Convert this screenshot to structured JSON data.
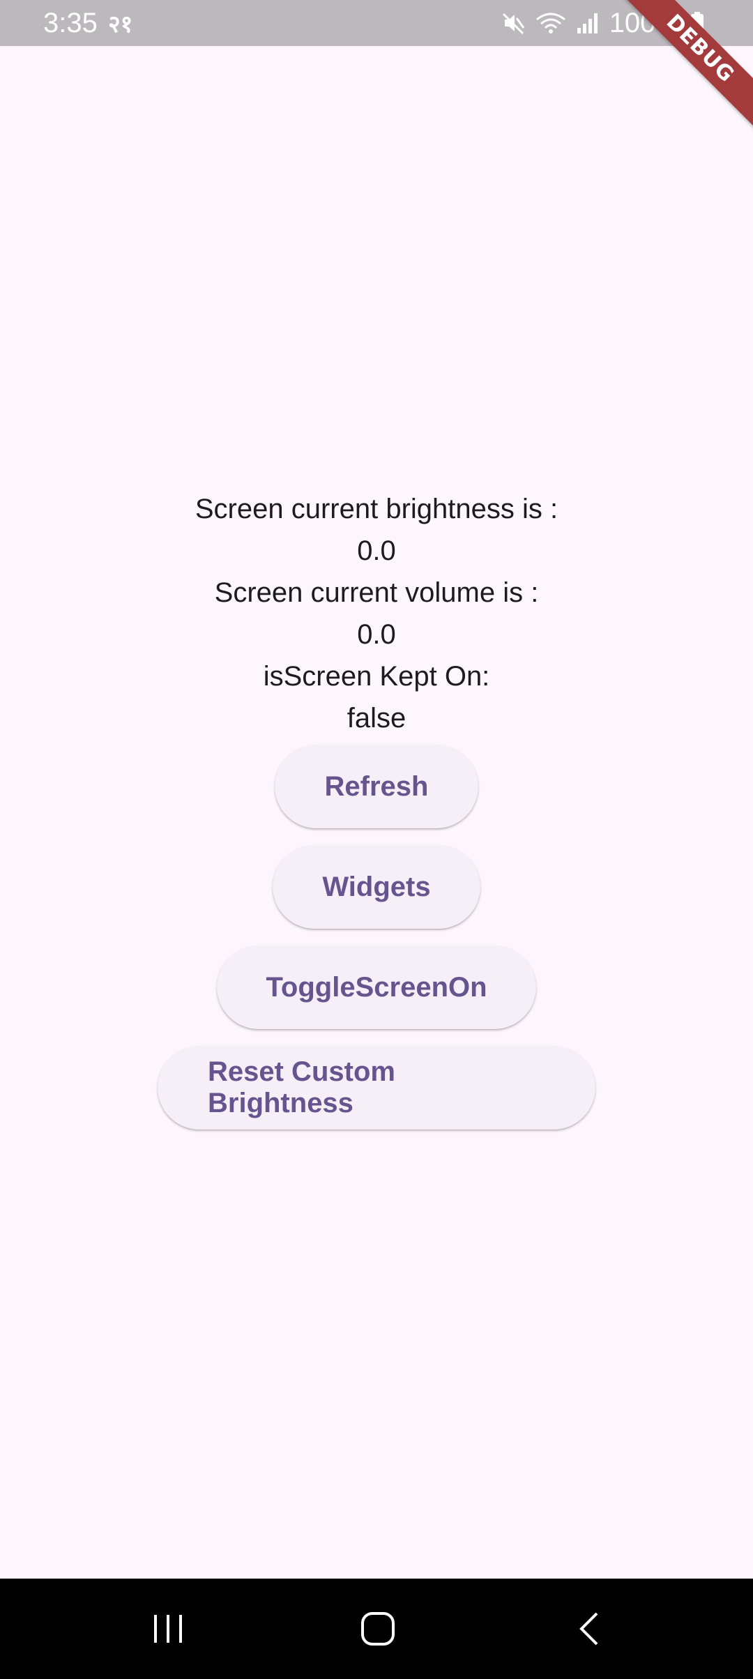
{
  "status_bar": {
    "time": "3:35",
    "extra_indicator": "२१",
    "battery_percent": "100%",
    "icons": [
      "mute-icon",
      "wifi-icon",
      "signal-icon",
      "battery-icon"
    ]
  },
  "debug_banner": {
    "label": "DEBUG",
    "color": "#a33a3c"
  },
  "info": {
    "brightness_label": "Screen current brightness is :",
    "brightness_value": "0.0",
    "volume_label": "Screen current volume is :",
    "volume_value": "0.0",
    "kept_on_label": "isScreen Kept On:",
    "kept_on_value": "false"
  },
  "buttons": {
    "refresh": "Refresh",
    "widgets": "Widgets",
    "toggle_screen_on": "ToggleScreenOn",
    "reset_custom_brightness": "Reset Custom Brightness"
  },
  "colors": {
    "background": "#fdf7fd",
    "button_background": "#f5eff7",
    "button_text": "#65558f",
    "status_bar": "#bcb8bd",
    "nav_bar": "#000000"
  },
  "nav_bar": {
    "icons": [
      "recent-apps-icon",
      "home-icon",
      "back-icon"
    ]
  }
}
